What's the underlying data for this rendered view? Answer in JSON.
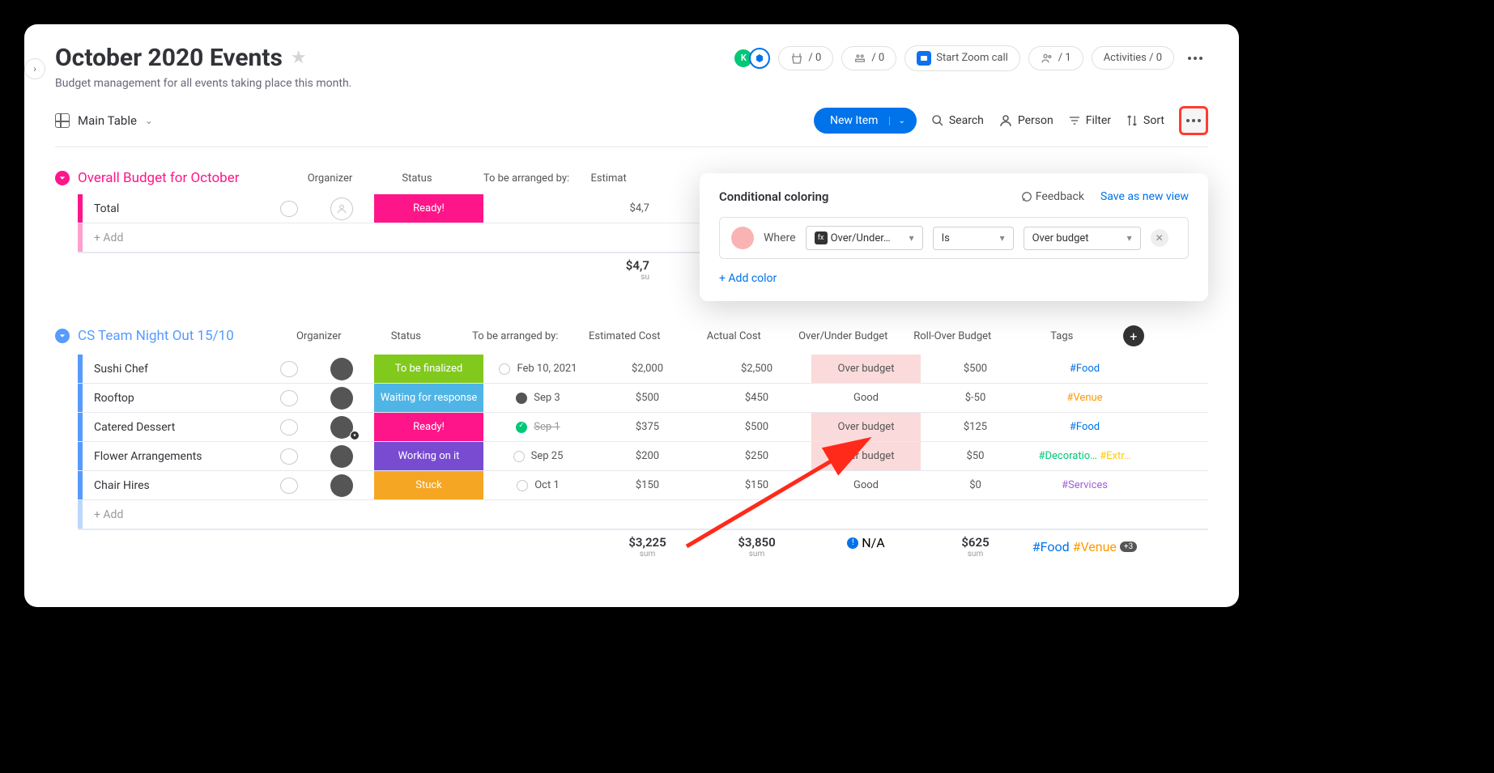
{
  "header": {
    "title": "October 2020 Events",
    "subtitle": "Budget management for all events taking place this month.",
    "collab_k": "K",
    "integrations_count": "/ 0",
    "automations_count": "/ 0",
    "zoom_label": "Start Zoom call",
    "members_count": "/ 1",
    "activities_label": "Activities / 0"
  },
  "toolbar": {
    "view_name": "Main Table",
    "new_item": "New Item",
    "search": "Search",
    "person": "Person",
    "filter": "Filter",
    "sort": "Sort"
  },
  "columns": {
    "organizer": "Organizer",
    "status": "Status",
    "arranged_by": "To be arranged by:",
    "estimated": "Estimated Cost",
    "actual": "Actual Cost",
    "over_under": "Over/Under Budget",
    "rollover": "Roll-Over Budget",
    "tags": "Tags"
  },
  "group1": {
    "name": "Overall Budget for October",
    "row_total_label": "Total",
    "row_total_status": "Ready!",
    "row_total_est": "$4,7",
    "add_label": "+ Add",
    "sum_est": "$4,7",
    "sum_lbl": "su"
  },
  "group2": {
    "name": "CS Team Night Out 15/10",
    "add_label": "+ Add",
    "sum_est": "$3,225",
    "sum_actual": "$3,850",
    "sum_na": "N/A",
    "sum_rollover": "$625",
    "sum_tag1": "#Food",
    "sum_tag2": "#Venue",
    "sum_extra": "+3",
    "sum_lbl": "sum",
    "rows": [
      {
        "name": "Sushi Chef",
        "status": "To be finalized",
        "status_color": "#82c91e",
        "date": "Feb 10, 2021",
        "date_state": "open",
        "est": "$2,000",
        "actual": "$2,500",
        "bud": "Over budget",
        "bud_over": true,
        "roll": "$500",
        "tags": [
          {
            "t": "#Food",
            "c": "tag-food"
          }
        ]
      },
      {
        "name": "Rooftop",
        "status": "Waiting for response",
        "status_color": "#4fb5e6",
        "date": "Sep 3",
        "date_state": "dark",
        "est": "$500",
        "actual": "$450",
        "bud": "Good",
        "bud_over": false,
        "roll": "$-50",
        "tags": [
          {
            "t": "#Venue",
            "c": "tag-venue"
          }
        ]
      },
      {
        "name": "Catered Dessert",
        "status": "Ready!",
        "status_color": "#ff158a",
        "date": "Sep 1",
        "date_state": "done",
        "date_strike": true,
        "est": "$375",
        "actual": "$500",
        "bud": "Over budget",
        "bud_over": true,
        "roll": "$125",
        "tags": [
          {
            "t": "#Food",
            "c": "tag-food"
          }
        ],
        "badge": true
      },
      {
        "name": "Flower Arrangements",
        "status": "Working on it",
        "status_color": "#784bd1",
        "date": "Sep 25",
        "date_state": "open",
        "est": "$200",
        "actual": "$250",
        "bud": "Over budget",
        "bud_over": true,
        "roll": "$50",
        "tags": [
          {
            "t": "#Decoratio…",
            "c": "tag-deco"
          },
          {
            "t": "#Extr…",
            "c": "tag-extra"
          }
        ]
      },
      {
        "name": "Chair Hires",
        "status": "Stuck",
        "status_color": "#f5a623",
        "date": "Oct 1",
        "date_state": "open",
        "est": "$150",
        "actual": "$150",
        "bud": "Good",
        "bud_over": false,
        "roll": "$0",
        "tags": [
          {
            "t": "#Services",
            "c": "tag-serv"
          }
        ]
      }
    ]
  },
  "cond": {
    "title": "Conditional coloring",
    "feedback": "Feedback",
    "save": "Save as new view",
    "where": "Where",
    "field": "Over/Under…",
    "op": "Is",
    "value": "Over budget",
    "add_color": "+ Add color"
  },
  "status_colors": {
    "ready": "#ff158a"
  }
}
